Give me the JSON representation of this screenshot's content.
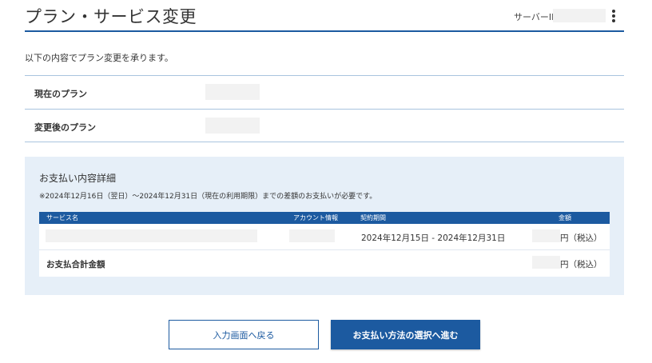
{
  "header": {
    "title": "プラン・サービス変更",
    "server_id_label": "サーバーID",
    "server_id_value": ""
  },
  "intro": "以下の内容でプラン変更を承ります。",
  "plan": {
    "current_label": "現在のプラン",
    "current_value": "",
    "new_label": "変更後のプラン",
    "new_value": ""
  },
  "payment": {
    "title": "お支払い内容詳細",
    "note": "※2024年12月16日（翌日）〜2024年12月31日（現在の利用期限）までの差額のお支払いが必要です。",
    "columns": {
      "service": "サービス名",
      "account": "アカウント情報",
      "period": "契約期間",
      "amount": "金額"
    },
    "row": {
      "service": "",
      "account": "",
      "period": "2024年12月15日 - 2024年12月31日",
      "amount_suffix": "円（税込）"
    },
    "total": {
      "label": "お支払合計金額",
      "amount_suffix": "円（税込）"
    }
  },
  "buttons": {
    "back": "入力画面へ戻る",
    "next": "お支払い方法の選択へ進む"
  },
  "colors": {
    "accent": "#1c5aa0",
    "panel_bg": "#e6eff8",
    "divider": "#a9c4de"
  }
}
